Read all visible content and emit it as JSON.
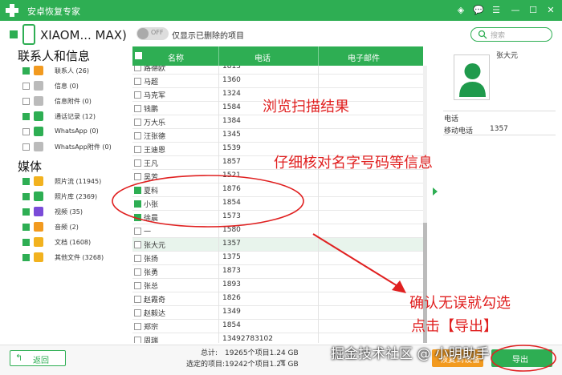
{
  "app": {
    "title": "安卓恢复专家",
    "controls": {
      "wifi": "◈",
      "chat": "💬",
      "menu": "☰",
      "minimize": "—",
      "maximize": "☐",
      "close": "✕"
    },
    "accent": "#2eae53"
  },
  "device": {
    "name": "XIAOM... MAX)",
    "toggle_text": "OFF",
    "toggle_label": "仅显示已删除的项目"
  },
  "search": {
    "placeholder": "搜索"
  },
  "sidebar": {
    "section_contacts": "联系人和信息",
    "contacts_items": [
      {
        "label": "联系人 (26)",
        "checked": true,
        "icon": "contacts-icon",
        "color": "#f29a1f"
      },
      {
        "label": "信息 (0)",
        "checked": false,
        "icon": "message-icon",
        "color": "#bbbbbb"
      },
      {
        "label": "信息附件 (0)",
        "checked": false,
        "icon": "attachment-icon",
        "color": "#bbbbbb"
      },
      {
        "label": "通话记录 (12)",
        "checked": true,
        "icon": "call-log-icon",
        "color": "#2eae53"
      },
      {
        "label": "WhatsApp (0)",
        "checked": false,
        "icon": "whatsapp-icon",
        "color": "#2eae53"
      },
      {
        "label": "WhatsApp附件 (0)",
        "checked": false,
        "icon": "whatsapp-attachment-icon",
        "color": "#bbbbbb"
      }
    ],
    "section_media": "媒体",
    "media_items": [
      {
        "label": "照片流 (11945)",
        "checked": true,
        "icon": "photo-stream-icon",
        "color": "#f2b21f"
      },
      {
        "label": "照片库 (2369)",
        "checked": true,
        "icon": "photo-library-icon",
        "color": "#2eae53"
      },
      {
        "label": "视频 (35)",
        "checked": true,
        "icon": "video-icon",
        "color": "#7a4bd8"
      },
      {
        "label": "音频 (2)",
        "checked": true,
        "icon": "audio-icon",
        "color": "#f29a1f"
      },
      {
        "label": "文档 (1608)",
        "checked": true,
        "icon": "document-icon",
        "color": "#f2b21f"
      },
      {
        "label": "其他文件 (3268)",
        "checked": true,
        "icon": "other-files-icon",
        "color": "#f2b21f"
      }
    ]
  },
  "table": {
    "headers": {
      "name": "名称",
      "phone": "电话",
      "email": "电子邮件"
    },
    "rows": [
      {
        "name": "路德欧",
        "phone": "1813",
        "checked": false
      },
      {
        "name": "马超",
        "phone": "1360",
        "checked": false
      },
      {
        "name": "马克军",
        "phone": "1324",
        "checked": false
      },
      {
        "name": "钱鹏",
        "phone": "1584",
        "checked": false
      },
      {
        "name": "万大乐",
        "phone": "1384",
        "checked": false
      },
      {
        "name": "汪张德",
        "phone": "1345",
        "checked": false
      },
      {
        "name": "王迪恩",
        "phone": "1539",
        "checked": false
      },
      {
        "name": "王凡",
        "phone": "1857",
        "checked": false
      },
      {
        "name": "吴芳",
        "phone": "1521",
        "checked": false
      },
      {
        "name": "夏科",
        "phone": "1876",
        "checked": true
      },
      {
        "name": "小张",
        "phone": "1854",
        "checked": true
      },
      {
        "name": "徐晨",
        "phone": "1573",
        "checked": true
      },
      {
        "name": "一",
        "phone": "1580",
        "checked": false
      },
      {
        "name": "张大元",
        "phone": "1357",
        "checked": false,
        "selected": true
      },
      {
        "name": "张扬",
        "phone": "1375",
        "checked": false
      },
      {
        "name": "张勇",
        "phone": "1873",
        "checked": false
      },
      {
        "name": "张总",
        "phone": "1893",
        "checked": false
      },
      {
        "name": "赵霞奇",
        "phone": "1826",
        "checked": false
      },
      {
        "name": "赵毅达",
        "phone": "1349",
        "checked": false
      },
      {
        "name": "郑宗",
        "phone": "1854",
        "checked": false
      },
      {
        "name": "周瑞",
        "phone": "13492783102",
        "checked": false
      }
    ]
  },
  "detail": {
    "name": "张大元",
    "phone_section": "电话",
    "phone_label": "移动电话",
    "phone_value": "1357"
  },
  "footer": {
    "back_label": "返回",
    "total_label": "总计:",
    "total_value": "19265个项目1.24 GB",
    "selected_label": "选定的项目:",
    "selected_value": "19242个项目1.24 GB",
    "restore_label": "恢复到设备",
    "export_label": "导出"
  },
  "annotations": {
    "a1": "浏览扫描结果",
    "a2": "仔细核对名字号码等信息",
    "a3": "确认无误就勾选",
    "a4": "点击【导出】",
    "color": "#e02020"
  },
  "watermark": "掘金技术社区 @ 小明助手"
}
